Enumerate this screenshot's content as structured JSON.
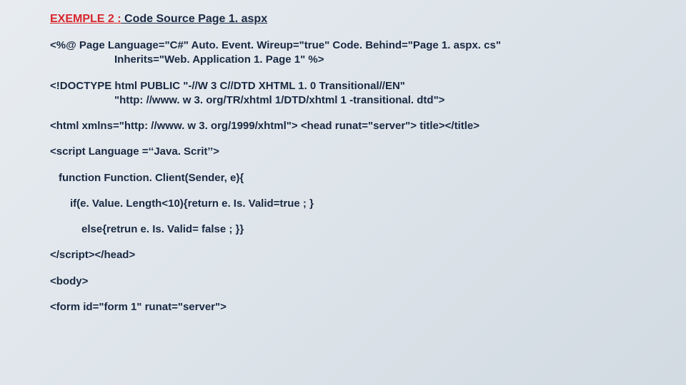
{
  "title": {
    "prefix": "EXEMPLE 2 :",
    "rest": " Code Source Page 1. aspx"
  },
  "lines": {
    "l1a": "<%@ Page Language=\"C#\" Auto. Event. Wireup=\"true\" Code. Behind=\"Page 1. aspx. cs\"",
    "l1b": "Inherits=\"Web. Application 1. Page 1\" %>",
    "l2a": "<!DOCTYPE html PUBLIC \"-//W 3 C//DTD XHTML 1. 0 Transitional//EN\"",
    "l2b": "\"http: //www. w 3. org/TR/xhtml 1/DTD/xhtml 1 -transitional. dtd\">",
    "l3": "<html xmlns=\"http: //www. w 3. org/1999/xhtml\"> <head runat=\"server\"> title></title>",
    "l4": "<script Language =‘‘Java. Scrit’’>",
    "l5": "function Function. Client(Sender, e){",
    "l6": "if(e. Value. Length<10){return e. Is. Valid=true ; }",
    "l7": "else{retrun e. Is. Valid= false ; }}",
    "l8": "</script></head>",
    "l9": "<body>",
    "l10": "<form id=\"form 1\" runat=\"server\">"
  }
}
